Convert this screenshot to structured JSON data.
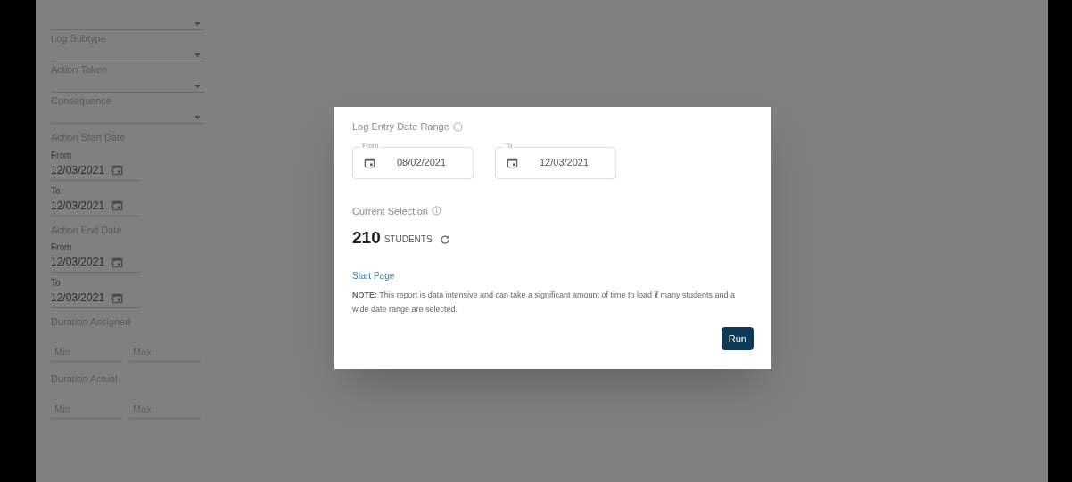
{
  "sidebar": {
    "fields": [
      {
        "kind": "select"
      },
      {
        "kind": "select",
        "label": "Log Subtype"
      },
      {
        "kind": "select",
        "label": "Action Taken"
      },
      {
        "kind": "select",
        "label": "Consequence"
      },
      {
        "kind": "heading",
        "label": "Action Start Date"
      },
      {
        "kind": "date",
        "label": "From",
        "value": "12/03/2021"
      },
      {
        "kind": "date",
        "label": "To",
        "value": "12/03/2021"
      },
      {
        "kind": "heading",
        "label": "Action End Date"
      },
      {
        "kind": "date",
        "label": "From",
        "value": "12/03/2021"
      },
      {
        "kind": "date",
        "label": "To",
        "value": "12/03/2021"
      },
      {
        "kind": "heading",
        "label": "Duration Assigned"
      },
      {
        "kind": "minmax",
        "min_placeholder": "Min",
        "max_placeholder": "Max"
      },
      {
        "kind": "heading",
        "label": "Duration Actual"
      },
      {
        "kind": "minmax",
        "min_placeholder": "Min",
        "max_placeholder": "Max"
      }
    ]
  },
  "dialog": {
    "date_range": {
      "title": "Log Entry Date Range",
      "from": {
        "label": "From",
        "value": "08/02/2021"
      },
      "to": {
        "label": "To",
        "value": "12/03/2021"
      }
    },
    "selection": {
      "title": "Current Selection",
      "count": "210",
      "unit": "STUDENTS"
    },
    "link": "Start Page",
    "note": "**NOTE:** This report is data intensive and can take a significant amount of time to load if many students and a wide date range are selected.",
    "button": "Run"
  }
}
